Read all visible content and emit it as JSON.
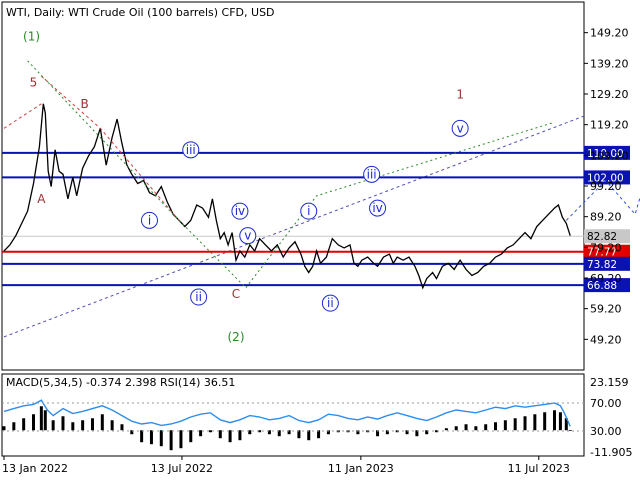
{
  "header": "WTI, Daily:  WTI Crude Oil (100 barrels) CFD, USD",
  "colors": {
    "bg": "#ffffff",
    "price": "#000000",
    "grid": "#c8c8c8",
    "blue_level": "#0a12b4",
    "red_level": "#e00000",
    "wave_green": "#2a8a2a",
    "wave_dark_red": "#a03030",
    "wave_blue": "#1a2ad0",
    "channel": "#5050b0",
    "macd_line": "#2d8ef0",
    "macd_hist": "#000000"
  },
  "chart_data": [
    {
      "type": "line",
      "title": "WTI, Daily:  WTI Crude Oil (100 barrels) CFD, USD",
      "x_tick_labels": [
        "13 Jan 2022",
        "13 Jul 2022",
        "11 Jan 2023",
        "11 Jul 2023"
      ],
      "x_ticks_days": [
        0,
        181,
        363,
        544
      ],
      "y_tick_labels": [
        "149.20",
        "139.20",
        "129.20",
        "119.20",
        "109.20",
        "99.20",
        "89.20",
        "79.20",
        "69.20",
        "59.20",
        "49.20"
      ],
      "ylim": [
        39.2,
        159.2
      ],
      "series": [
        {
          "points": [
            [
              0,
              78
            ],
            [
              6,
              80
            ],
            [
              12,
              83
            ],
            [
              18,
              87
            ],
            [
              24,
              91
            ],
            [
              30,
              100
            ],
            [
              36,
              112
            ],
            [
              40,
              126
            ],
            [
              42,
              123
            ],
            [
              45,
              104
            ],
            [
              48,
              99
            ],
            [
              52,
              111
            ],
            [
              56,
              104
            ],
            [
              60,
              103
            ],
            [
              65,
              95
            ],
            [
              70,
              102
            ],
            [
              74,
              96
            ],
            [
              80,
              105
            ],
            [
              86,
              109
            ],
            [
              92,
              112
            ],
            [
              98,
              118
            ],
            [
              104,
              106
            ],
            [
              110,
              115
            ],
            [
              115,
              121
            ],
            [
              120,
              113
            ],
            [
              125,
              106
            ],
            [
              130,
              103
            ],
            [
              136,
              100
            ],
            [
              142,
              101
            ],
            [
              148,
              97
            ],
            [
              154,
              96
            ],
            [
              160,
              99
            ],
            [
              166,
              94
            ],
            [
              172,
              90
            ],
            [
              178,
              88
            ],
            [
              184,
              86
            ],
            [
              190,
              88
            ],
            [
              196,
              93
            ],
            [
              202,
              92
            ],
            [
              208,
              89
            ],
            [
              212,
              95
            ],
            [
              216,
              88
            ],
            [
              220,
              82
            ],
            [
              224,
              84
            ],
            [
              228,
              80
            ],
            [
              232,
              84
            ],
            [
              236,
              75
            ],
            [
              240,
              78
            ],
            [
              245,
              76
            ],
            [
              250,
              80
            ],
            [
              255,
              78
            ],
            [
              260,
              82
            ],
            [
              266,
              80
            ],
            [
              272,
              78
            ],
            [
              278,
              80
            ],
            [
              284,
              76
            ],
            [
              290,
              79
            ],
            [
              296,
              81
            ],
            [
              302,
              77
            ],
            [
              306,
              73
            ],
            [
              310,
              71
            ],
            [
              314,
              73
            ],
            [
              318,
              78
            ],
            [
              322,
              74
            ],
            [
              328,
              76
            ],
            [
              334,
              82
            ],
            [
              340,
              80
            ],
            [
              346,
              79
            ],
            [
              352,
              80
            ],
            [
              356,
              74
            ],
            [
              360,
              73
            ],
            [
              364,
              75
            ],
            [
              370,
              76
            ],
            [
              376,
              74
            ],
            [
              380,
              73
            ],
            [
              386,
              76
            ],
            [
              392,
              77
            ],
            [
              396,
              74
            ],
            [
              400,
              76
            ],
            [
              406,
              75
            ],
            [
              412,
              76
            ],
            [
              418,
              73
            ],
            [
              422,
              70
            ],
            [
              426,
              66
            ],
            [
              430,
              69
            ],
            [
              436,
              71
            ],
            [
              440,
              69
            ],
            [
              446,
              73
            ],
            [
              452,
              74
            ],
            [
              458,
              72
            ],
            [
              464,
              75
            ],
            [
              470,
              72
            ],
            [
              476,
              70
            ],
            [
              482,
              71
            ],
            [
              488,
              73
            ],
            [
              494,
              74
            ],
            [
              500,
              76
            ],
            [
              506,
              77
            ],
            [
              512,
              79
            ],
            [
              518,
              80
            ],
            [
              524,
              82
            ],
            [
              530,
              84
            ],
            [
              536,
              82
            ],
            [
              542,
              86
            ],
            [
              548,
              88
            ],
            [
              554,
              90
            ],
            [
              560,
              92
            ],
            [
              564,
              93
            ],
            [
              568,
              89
            ],
            [
              572,
              87
            ],
            [
              576,
              83
            ]
          ]
        }
      ],
      "levels": [
        {
          "value": 110.0,
          "label": "110.00",
          "color": "#0a12b4"
        },
        {
          "value": 102.0,
          "label": "102.00",
          "color": "#0a12b4"
        },
        {
          "value": 77.77,
          "label": "77.77",
          "color": "#e00000"
        },
        {
          "value": 73.82,
          "label": "73.82",
          "color": "#0a12b4"
        },
        {
          "value": 66.88,
          "label": "66.88",
          "color": "#0a12b4"
        }
      ],
      "current_price": {
        "value": 82.82,
        "label": "82.82"
      },
      "wave_labels": [
        {
          "text": "(1)",
          "color": "#2a8a2a",
          "circled": false
        },
        {
          "text": "5",
          "color": "#a03030",
          "circled": false
        },
        {
          "text": "A",
          "color": "#a03030",
          "circled": false
        },
        {
          "text": "B",
          "color": "#a03030",
          "circled": false
        },
        {
          "text": "C",
          "color": "#a03030",
          "circled": false
        },
        {
          "text": "(2)",
          "color": "#2a8a2a",
          "circled": false
        },
        {
          "text": "1",
          "color": "#a03030",
          "circled": false
        },
        {
          "text": "i",
          "color": "#1a2ad0",
          "circled": true
        },
        {
          "text": "ii",
          "color": "#1a2ad0",
          "circled": true
        },
        {
          "text": "iii",
          "color": "#1a2ad0",
          "circled": true
        },
        {
          "text": "iv",
          "color": "#1a2ad0",
          "circled": true
        },
        {
          "text": "v",
          "color": "#1a2ad0",
          "circled": true
        },
        {
          "text": "i",
          "color": "#1a2ad0",
          "circled": true
        },
        {
          "text": "ii",
          "color": "#1a2ad0",
          "circled": true
        },
        {
          "text": "iii",
          "color": "#1a2ad0",
          "circled": true
        },
        {
          "text": "iv",
          "color": "#1a2ad0",
          "circled": true
        },
        {
          "text": "v",
          "color": "#1a2ad0",
          "circled": true
        }
      ]
    },
    {
      "type": "area",
      "title": "MACD(5,34,5) -0.374 2.398 RSI(14) 36.51",
      "y_tick_labels": [
        "23.159",
        "70.00",
        "30.00",
        "-11.905"
      ],
      "rsi_levels": [
        70,
        30
      ],
      "series": [
        {
          "name": "MACD",
          "points": [
            [
              0,
              2
            ],
            [
              10,
              4
            ],
            [
              20,
              6
            ],
            [
              30,
              8
            ],
            [
              38,
              12
            ],
            [
              42,
              10
            ],
            [
              50,
              5
            ],
            [
              60,
              7
            ],
            [
              70,
              4
            ],
            [
              80,
              5
            ],
            [
              90,
              6
            ],
            [
              100,
              8
            ],
            [
              110,
              5
            ],
            [
              120,
              3
            ],
            [
              130,
              -2
            ],
            [
              140,
              -6
            ],
            [
              150,
              -7
            ],
            [
              160,
              -8
            ],
            [
              170,
              -10
            ],
            [
              180,
              -9
            ],
            [
              190,
              -6
            ],
            [
              200,
              -3
            ],
            [
              210,
              -1
            ],
            [
              220,
              -4
            ],
            [
              230,
              -6
            ],
            [
              240,
              -5
            ],
            [
              250,
              -2
            ],
            [
              260,
              -1
            ],
            [
              270,
              -2
            ],
            [
              280,
              -3
            ],
            [
              290,
              -2
            ],
            [
              300,
              -4
            ],
            [
              310,
              -5
            ],
            [
              320,
              -4
            ],
            [
              330,
              -2
            ],
            [
              340,
              -1
            ],
            [
              350,
              -1
            ],
            [
              360,
              -2
            ],
            [
              370,
              -1
            ],
            [
              380,
              -3
            ],
            [
              390,
              -2
            ],
            [
              400,
              -1
            ],
            [
              410,
              -2
            ],
            [
              420,
              -3
            ],
            [
              430,
              -2
            ],
            [
              440,
              -1
            ],
            [
              450,
              1
            ],
            [
              460,
              2
            ],
            [
              470,
              3
            ],
            [
              480,
              2
            ],
            [
              490,
              3
            ],
            [
              500,
              4
            ],
            [
              510,
              5
            ],
            [
              520,
              6
            ],
            [
              530,
              7
            ],
            [
              540,
              8
            ],
            [
              550,
              9
            ],
            [
              560,
              10
            ],
            [
              566,
              9
            ],
            [
              572,
              6
            ],
            [
              576,
              -0.374
            ]
          ]
        },
        {
          "name": "RSI",
          "points": [
            [
              0,
              58
            ],
            [
              10,
              62
            ],
            [
              20,
              66
            ],
            [
              30,
              68
            ],
            [
              38,
              74
            ],
            [
              44,
              60
            ],
            [
              50,
              52
            ],
            [
              60,
              62
            ],
            [
              70,
              55
            ],
            [
              80,
              58
            ],
            [
              90,
              62
            ],
            [
              100,
              66
            ],
            [
              110,
              60
            ],
            [
              120,
              52
            ],
            [
              130,
              44
            ],
            [
              140,
              40
            ],
            [
              150,
              42
            ],
            [
              160,
              38
            ],
            [
              170,
              40
            ],
            [
              180,
              44
            ],
            [
              190,
              50
            ],
            [
              200,
              54
            ],
            [
              210,
              56
            ],
            [
              220,
              46
            ],
            [
              230,
              42
            ],
            [
              240,
              46
            ],
            [
              250,
              52
            ],
            [
              260,
              50
            ],
            [
              270,
              46
            ],
            [
              280,
              48
            ],
            [
              290,
              52
            ],
            [
              300,
              45
            ],
            [
              310,
              42
            ],
            [
              320,
              46
            ],
            [
              330,
              54
            ],
            [
              340,
              52
            ],
            [
              350,
              48
            ],
            [
              360,
              46
            ],
            [
              370,
              50
            ],
            [
              380,
              47
            ],
            [
              390,
              52
            ],
            [
              400,
              56
            ],
            [
              410,
              52
            ],
            [
              420,
              48
            ],
            [
              430,
              45
            ],
            [
              440,
              50
            ],
            [
              450,
              56
            ],
            [
              460,
              60
            ],
            [
              470,
              58
            ],
            [
              480,
              56
            ],
            [
              490,
              60
            ],
            [
              500,
              64
            ],
            [
              510,
              62
            ],
            [
              520,
              66
            ],
            [
              530,
              64
            ],
            [
              540,
              66
            ],
            [
              550,
              68
            ],
            [
              560,
              70
            ],
            [
              566,
              66
            ],
            [
              570,
              56
            ],
            [
              576,
              36.51
            ]
          ]
        }
      ]
    }
  ]
}
